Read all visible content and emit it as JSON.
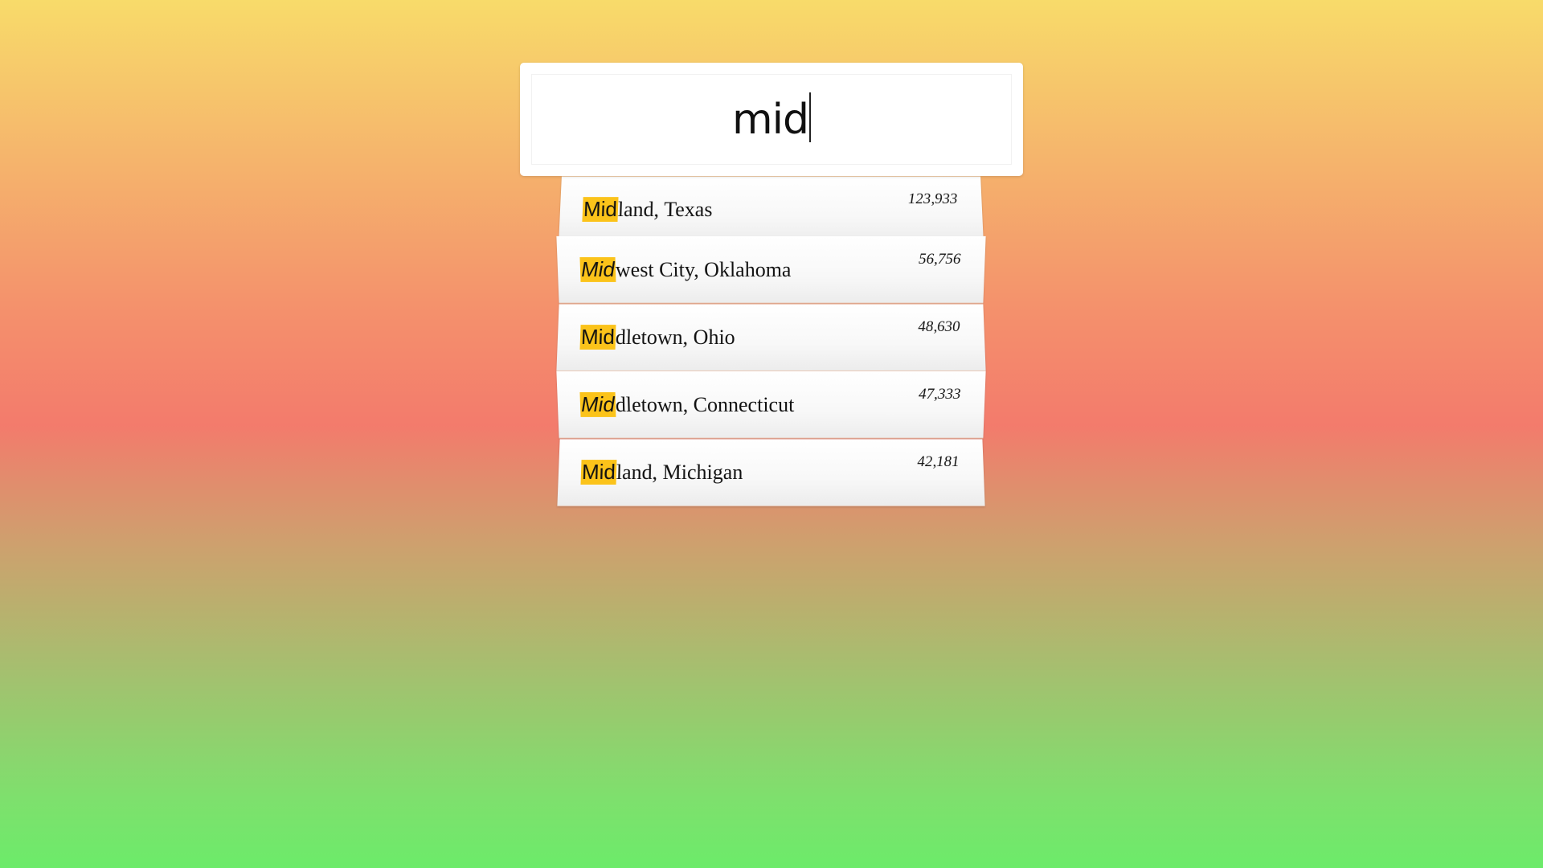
{
  "search": {
    "value": "mid"
  },
  "results": [
    {
      "match": "Mid",
      "rest": "land, Texas",
      "count": "123,933"
    },
    {
      "match": "Mid",
      "rest": "west City, Oklahoma",
      "count": "56,756"
    },
    {
      "match": "Mid",
      "rest": "dletown, Ohio",
      "count": "48,630"
    },
    {
      "match": "Mid",
      "rest": "dletown, Connecticut",
      "count": "47,333"
    },
    {
      "match": "Mid",
      "rest": "land, Michigan",
      "count": "42,181"
    }
  ],
  "colors": {
    "highlight": "#fbc31a"
  }
}
